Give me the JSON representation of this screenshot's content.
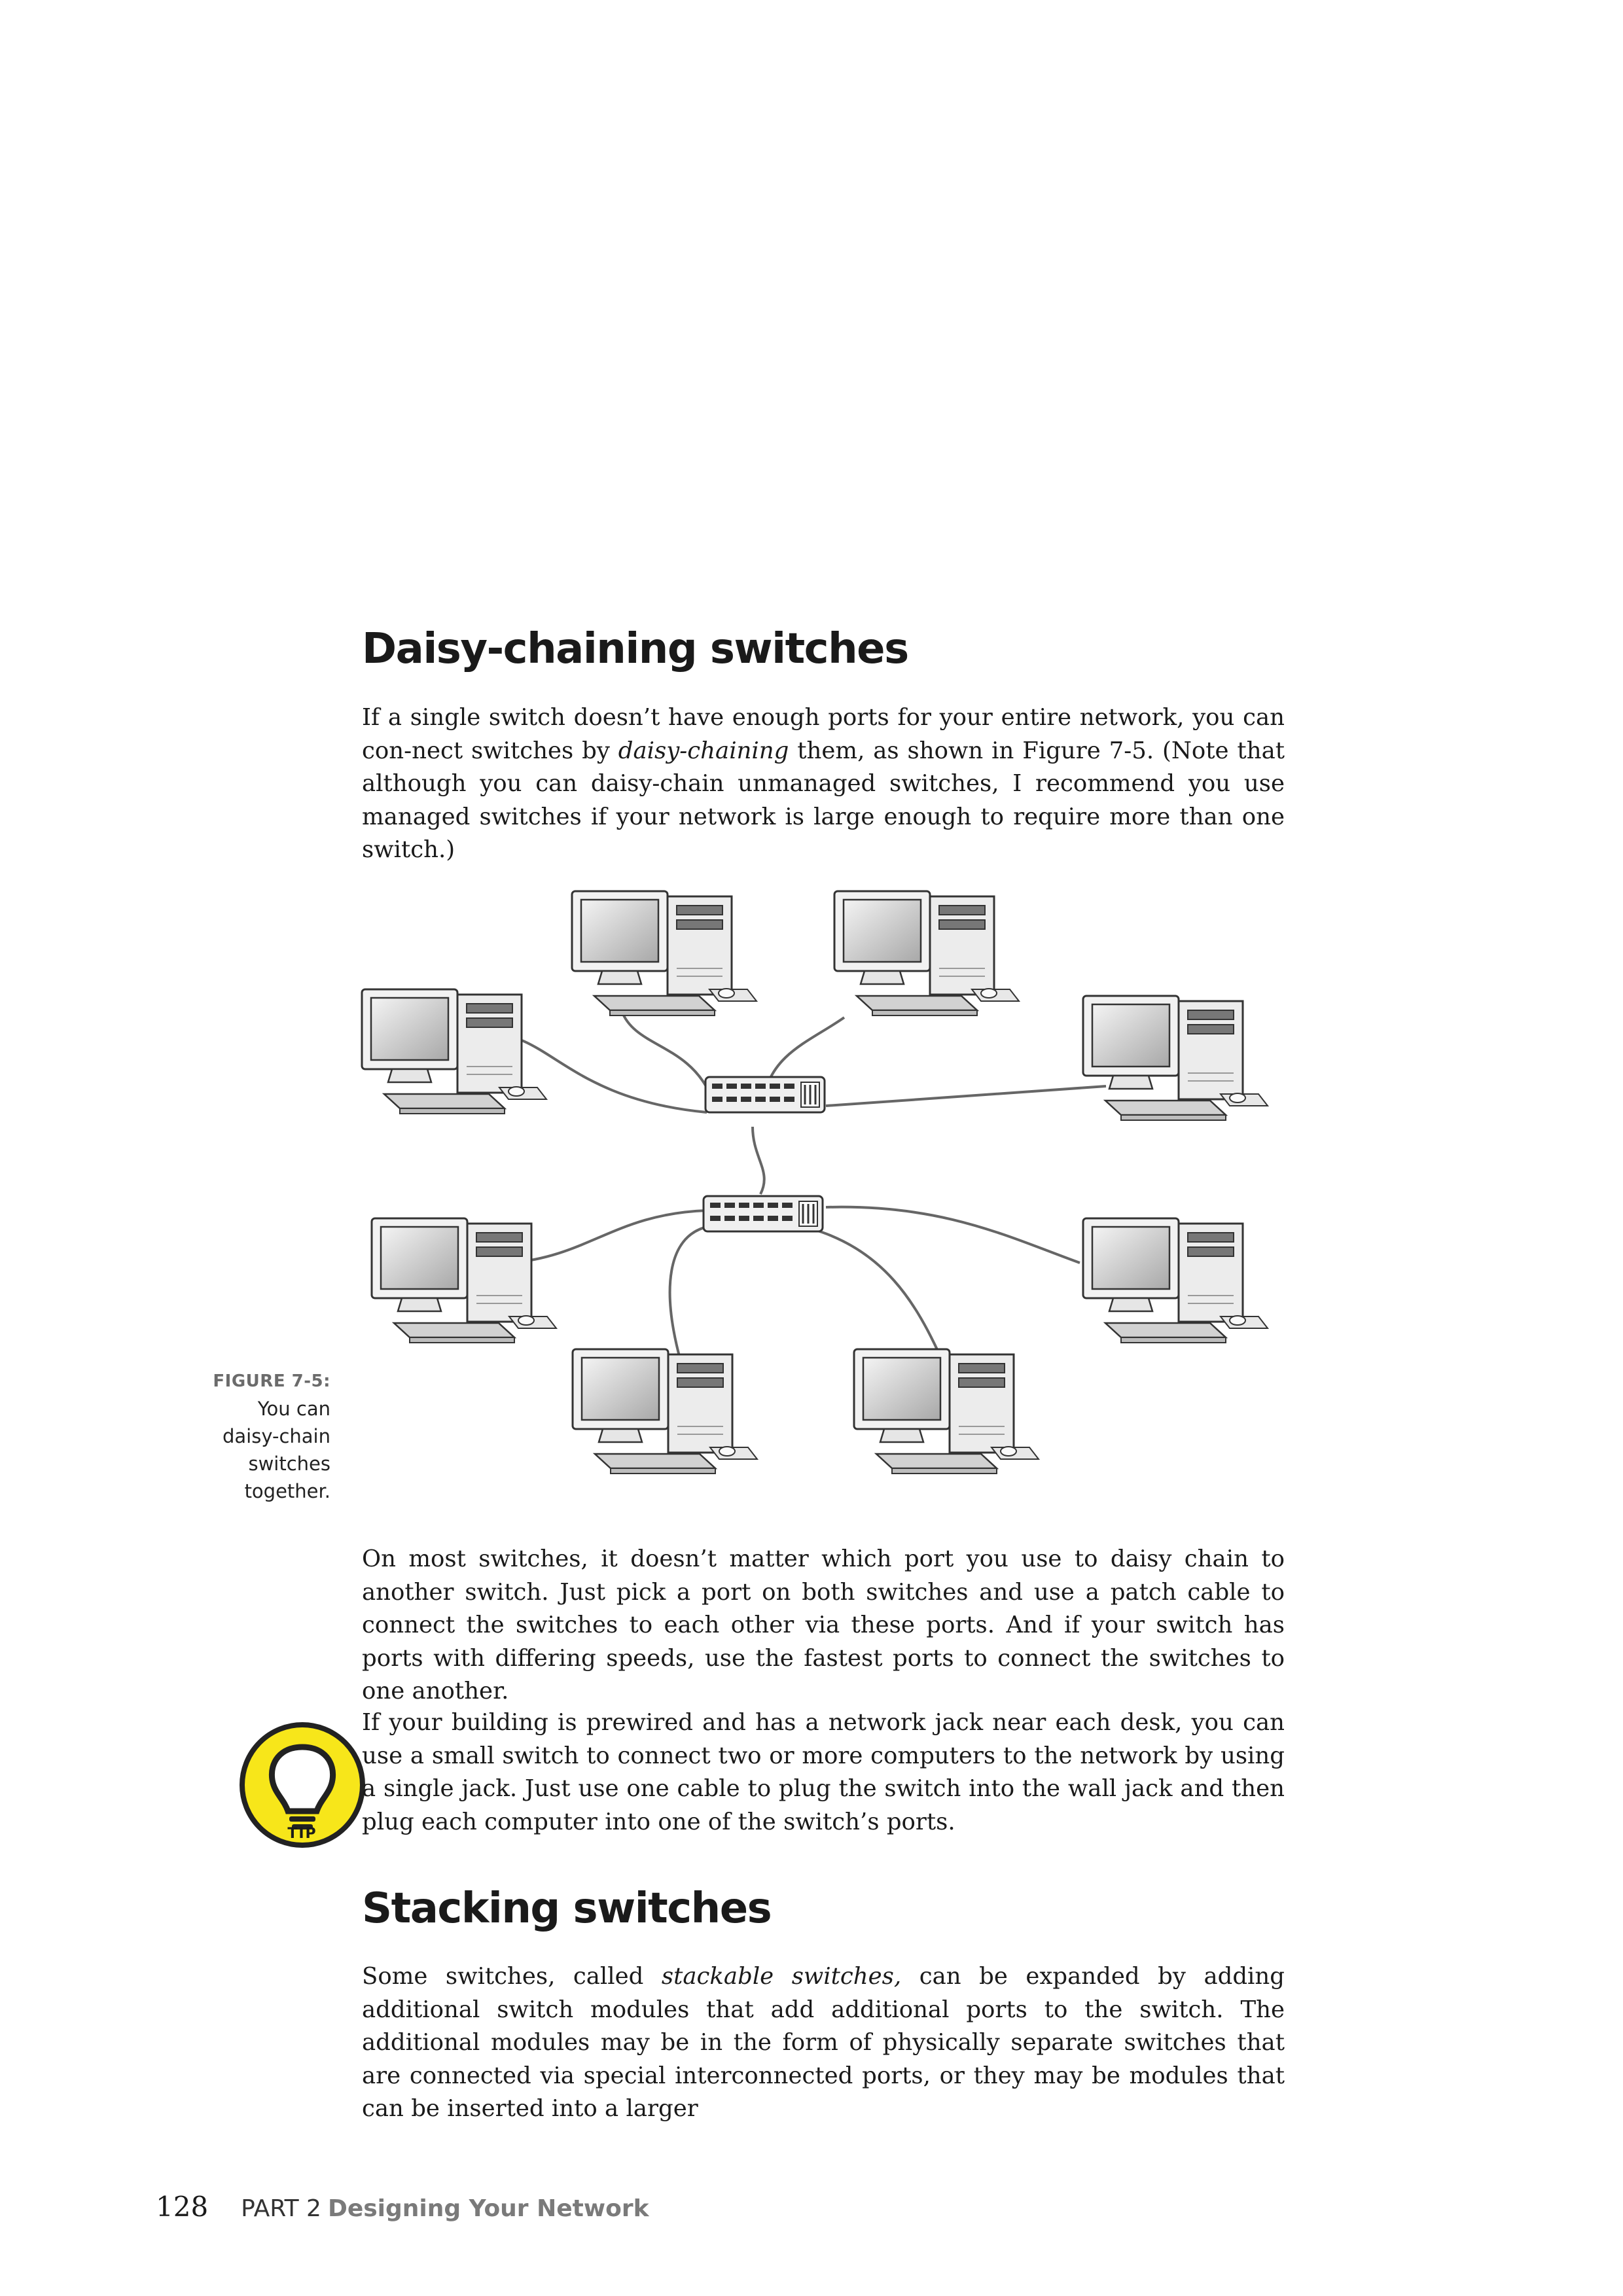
{
  "section1": {
    "heading": "Daisy-chaining switches",
    "p1_a": "If a single switch doesn’t have enough ports for your entire network, you can con-nect switches by ",
    "p1_em": "daisy-chaining",
    "p1_b": " them, as shown in Figure 7-5. (Note that although you can daisy-chain unmanaged switches, I recommend you use managed switches if your network is large enough to require more than one switch.)",
    "p2": "On most switches, it doesn’t matter which port you use to daisy chain to another switch. Just pick a port on both switches and use a patch cable to connect the switches to each other via these ports. And if your switch has ports with differing speeds, use the fastest ports to connect the switches to one another."
  },
  "figure": {
    "label": "FIGURE 7-5:",
    "caption": "You can daisy-chain switches together."
  },
  "tip": {
    "label": "TIP",
    "icon": "lightbulb-icon",
    "color": "#f7e61a",
    "text": "If your building is prewired and has a network jack near each desk, you can use a small switch to connect two or more computers to the network by using a single jack. Just use one cable to plug the switch into the wall jack and then plug each computer into one of the switch’s ports."
  },
  "section2": {
    "heading": "Stacking switches",
    "p1_a": "Some switches, called ",
    "p1_em": "stackable switches,",
    "p1_b": " can be expanded by adding additional switch modules that add additional ports to the switch. The additional modules may be in the form of physically separate switches that are connected via special interconnected ports, or they may be modules that can be inserted into a larger"
  },
  "footer": {
    "page_number": "128",
    "part": "PART 2",
    "part_title": "Designing Your Network"
  }
}
